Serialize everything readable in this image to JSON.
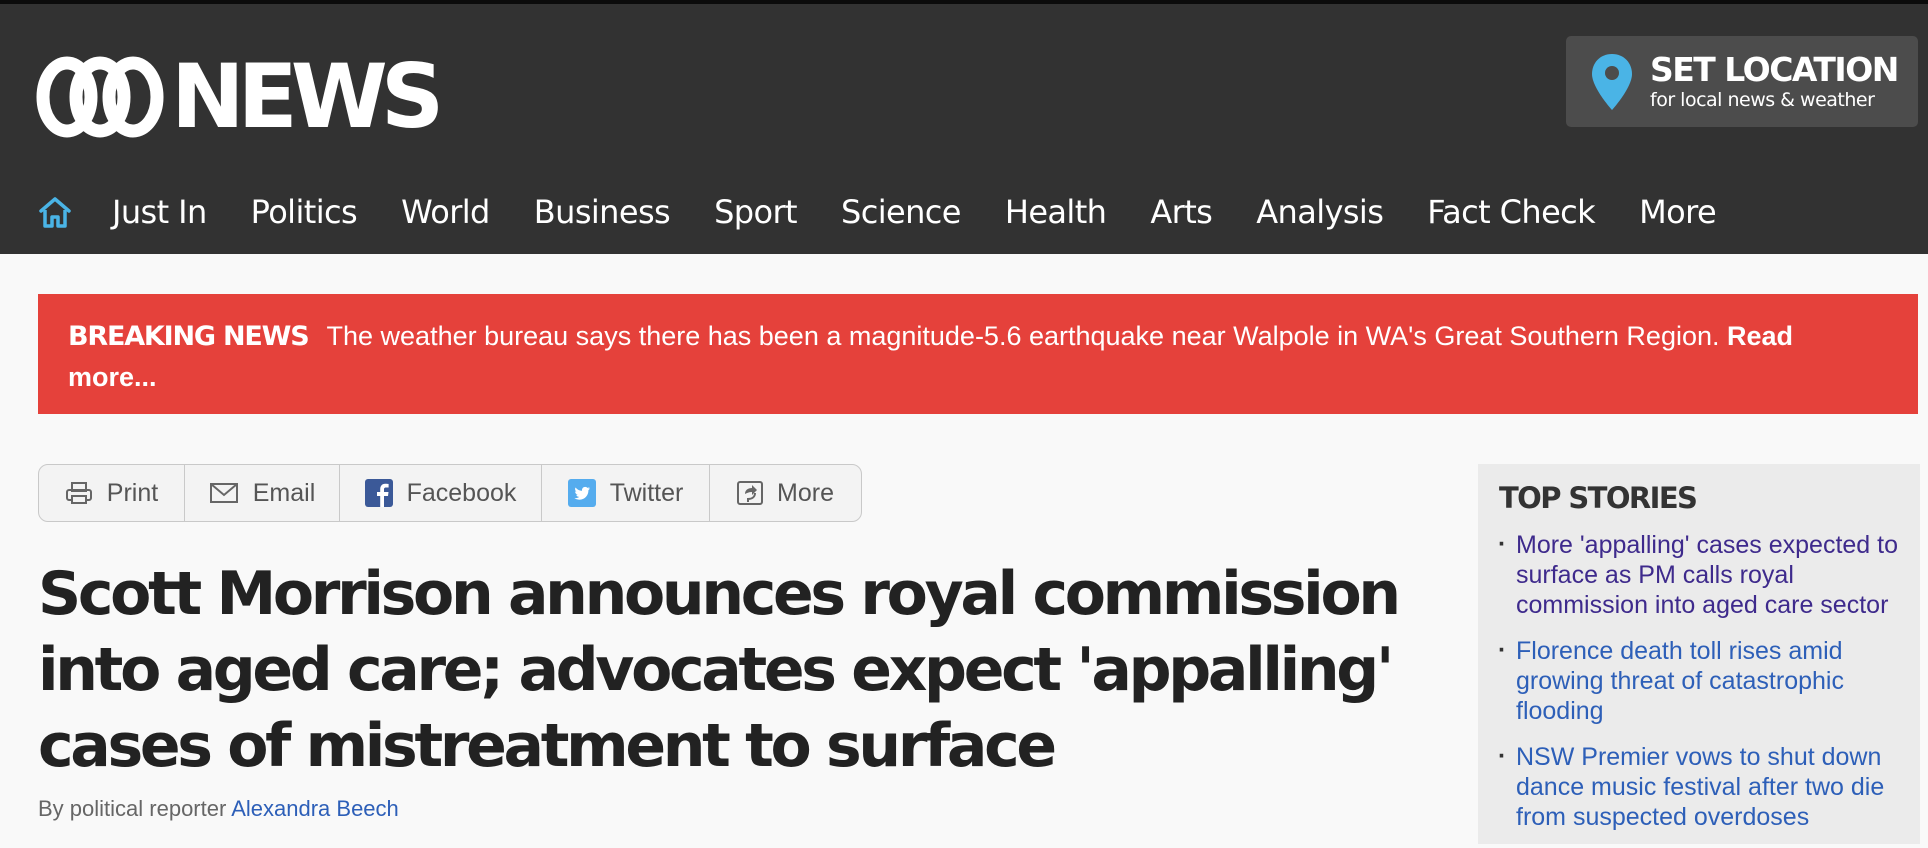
{
  "header": {
    "logo_text": "NEWS",
    "set_location": {
      "title": "SET LOCATION",
      "subtitle": "for local news & weather"
    }
  },
  "nav": {
    "items": [
      "Just In",
      "Politics",
      "World",
      "Business",
      "Sport",
      "Science",
      "Health",
      "Arts",
      "Analysis",
      "Fact Check",
      "More"
    ]
  },
  "breaking": {
    "label": "BREAKING NEWS",
    "text": "The weather bureau says there has been a magnitude-5.6 earthquake near Walpole in WA's Great Southern Region.",
    "read_more": "Read more..."
  },
  "share": {
    "print": "Print",
    "email": "Email",
    "facebook": "Facebook",
    "twitter": "Twitter",
    "more": "More"
  },
  "article": {
    "headline": "Scott Morrison announces royal commission into aged care; advocates expect 'appalling' cases of mistreatment to surface",
    "byline_prefix": "By political reporter",
    "author": "Alexandra Beech"
  },
  "top_stories": {
    "title": "TOP STORIES",
    "items": [
      "More 'appalling' cases expected to surface as PM calls royal commission into aged care sector",
      "Florence death toll rises amid growing threat of catastrophic flooding",
      "NSW Premier vows to shut down dance music festival after two die from suspected overdoses"
    ]
  },
  "colors": {
    "header": "#323232",
    "breaking": "#e5413b",
    "link": "#2d5fb8",
    "visited": "#3e2a8c",
    "accent": "#4ab4e6"
  }
}
